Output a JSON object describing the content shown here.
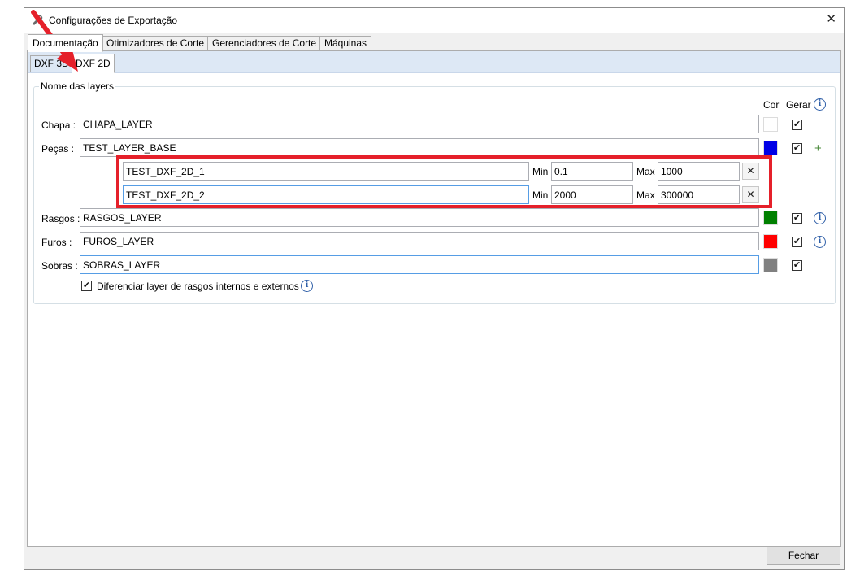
{
  "window": {
    "title": "Configurações de Exportação"
  },
  "tabs": [
    {
      "label": "Documentação"
    },
    {
      "label": "Otimizadores de Corte"
    },
    {
      "label": "Gerenciadores de Corte"
    },
    {
      "label": "Máquinas"
    }
  ],
  "subtabs": [
    {
      "label": "DXF 3D"
    },
    {
      "label": "DXF 2D"
    }
  ],
  "group": {
    "title": "Nome das layers"
  },
  "columns": {
    "cor": "Cor",
    "gerar": "Gerar"
  },
  "rows": {
    "chapa": {
      "label": "Chapa :",
      "value": "CHAPA_LAYER",
      "color": "#ffffff",
      "checked": "✔"
    },
    "pecas": {
      "label": "Peças :",
      "value": "TEST_LAYER_BASE",
      "color": "#0000e6",
      "checked": "✔"
    },
    "rasgos": {
      "label": "Rasgos :",
      "value": "RASGOS_LAYER",
      "color": "#008000",
      "checked": "✔"
    },
    "furos": {
      "label": "Furos :",
      "value": "FUROS_LAYER",
      "color": "#ff0000",
      "checked": "✔"
    },
    "sobras": {
      "label": "Sobras :",
      "value": "SOBRAS_LAYER",
      "color": "#808080",
      "checked": "✔"
    }
  },
  "sublayers": [
    {
      "value": "TEST_DXF_2D_1",
      "min_label": "Min",
      "min": "0.1",
      "max_label": "Max",
      "max": "1000"
    },
    {
      "value": "TEST_DXF_2D_2",
      "min_label": "Min",
      "min": "2000",
      "max_label": "Max",
      "max": "300000"
    }
  ],
  "differentiate": {
    "checked": "✔",
    "label": "Diferenciar layer de rasgos internos e externos"
  },
  "footer": {
    "close_label": "Fechar"
  },
  "glyphs": {
    "close": "✕",
    "remove": "✕",
    "add": "+",
    "info": "i"
  },
  "icons": {
    "app": "gear-wrench-icon",
    "annotation": "red-arrow-pointer"
  }
}
